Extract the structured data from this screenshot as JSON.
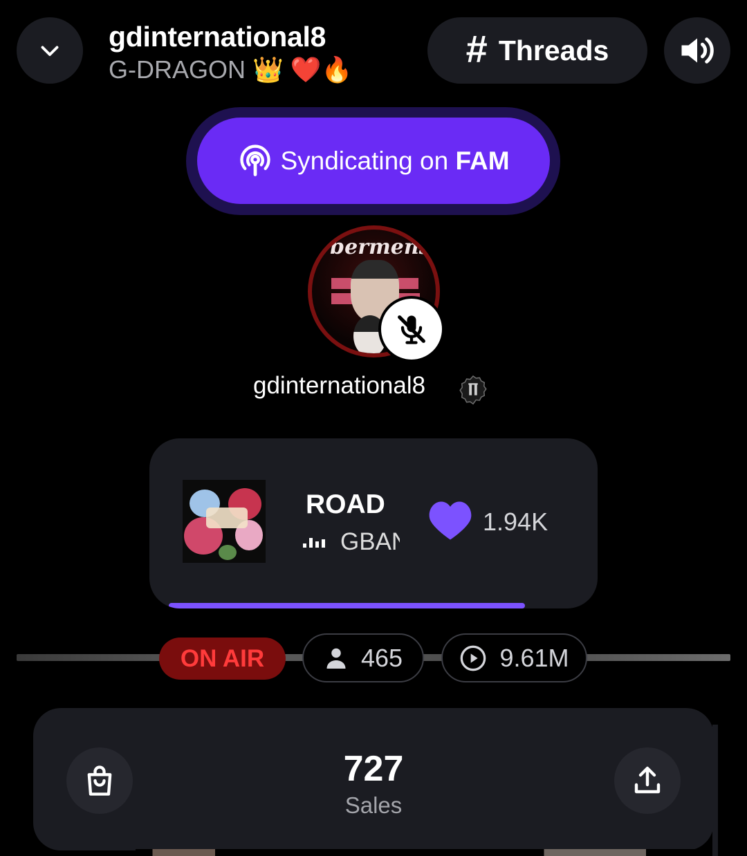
{
  "header": {
    "title": "gdinternational8",
    "subtitle": "G-DRAGON 👑 ❤️🔥",
    "threads_label": "Threads",
    "back_icon": "chevron-down-icon",
    "sound_icon": "speaker-icon"
  },
  "syndicate": {
    "prefix": "Syndicating on",
    "network": "FAM",
    "icon": "broadcast-icon",
    "color": "#6a2bf5"
  },
  "host": {
    "avatar_text": "Übermensch",
    "name": "gdinternational8",
    "mic_state_icon": "mic-off-icon",
    "badge_icon": "verified-badge-icon"
  },
  "now_playing": {
    "title": "ROAD",
    "artist_visible": "GBAN",
    "likes": "1.94K",
    "progress": 0.87,
    "accent": "#7c52ff"
  },
  "stats": {
    "status": "ON AIR",
    "listeners": "465",
    "plays": "9.61M"
  },
  "sales": {
    "value": "727",
    "label": "Sales"
  }
}
